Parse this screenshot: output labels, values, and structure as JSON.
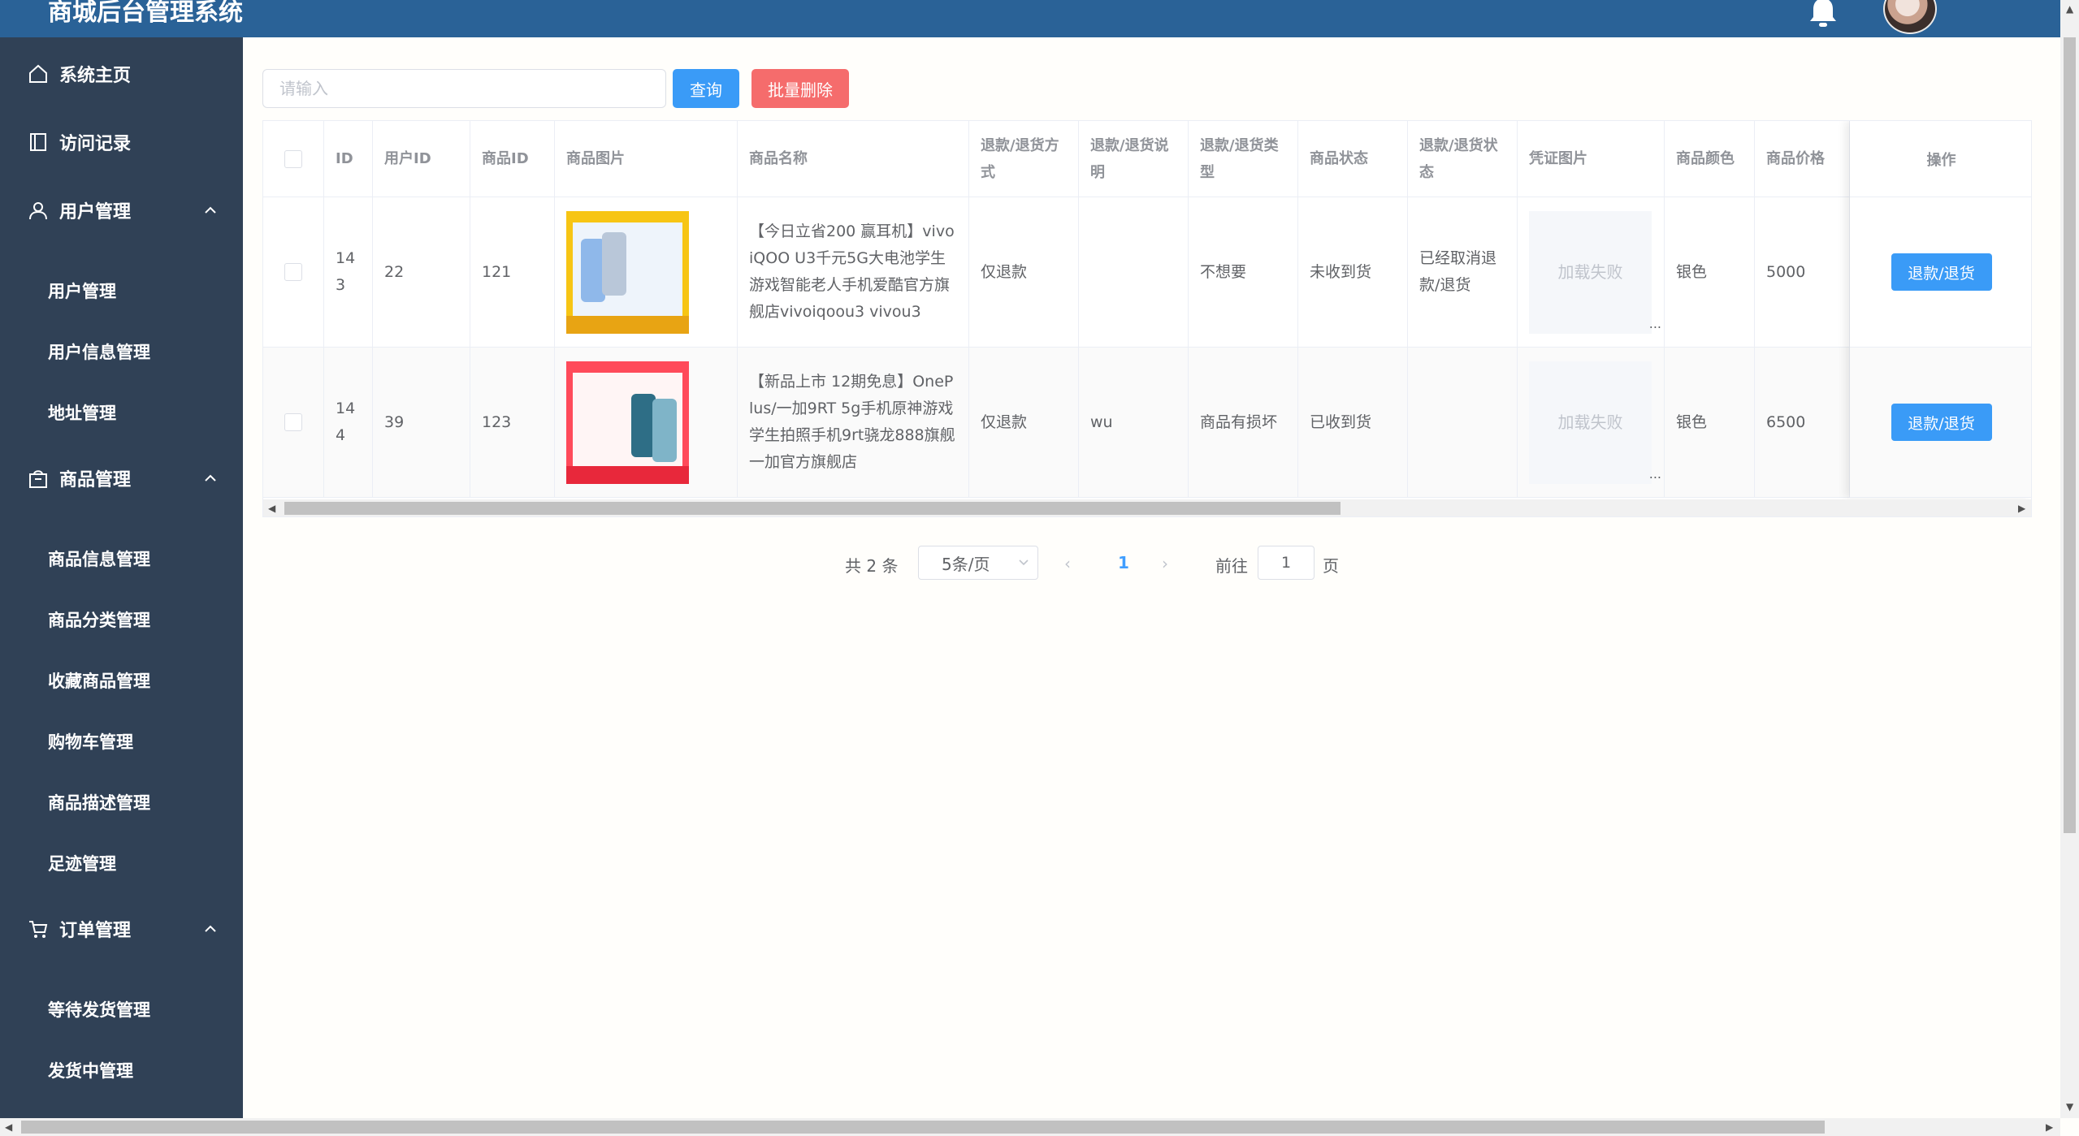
{
  "header": {
    "title": "商城后台管理系统"
  },
  "sidebar": {
    "items": [
      {
        "label": "系统主页",
        "icon": "home-icon"
      },
      {
        "label": "访问记录",
        "icon": "record-icon"
      },
      {
        "label": "用户管理",
        "icon": "user-icon",
        "expanded": true,
        "children": [
          "用户管理",
          "用户信息管理",
          "地址管理"
        ]
      },
      {
        "label": "商品管理",
        "icon": "goods-icon",
        "expanded": true,
        "children": [
          "商品信息管理",
          "商品分类管理",
          "收藏商品管理",
          "购物车管理",
          "商品描述管理",
          "足迹管理"
        ]
      },
      {
        "label": "订单管理",
        "icon": "cart-icon",
        "expanded": true,
        "children": [
          "等待发货管理",
          "发货中管理"
        ]
      }
    ]
  },
  "toolbar": {
    "search_placeholder": "请输入",
    "query_label": "查询",
    "batch_delete_label": "批量删除"
  },
  "table": {
    "columns": [
      "ID",
      "用户ID",
      "商品ID",
      "商品图片",
      "商品名称",
      "退款/退货方式",
      "退款/退货说明",
      "退款/退货类型",
      "商品状态",
      "退款/退货状态",
      "凭证图片",
      "商品颜色",
      "商品价格",
      "操作"
    ],
    "rows": [
      {
        "id": "143",
        "user_id": "22",
        "goods_id": "121",
        "image": "vivo-iqoo-product-image",
        "name": "【今日立省200 赢耳机】vivo iQOO U3千元5G大电池学生游戏智能老人手机爱酷官方旗舰店vivoiqoou3 vivou3",
        "method": "仅退款",
        "desc": "",
        "type": "不想要",
        "goods_status": "未收到货",
        "refund_status": "已经取消退款/退货",
        "voucher_text": "加载失败",
        "voucher_more": "...",
        "color": "银色",
        "price": "5000",
        "action": "退款/退货"
      },
      {
        "id": "144",
        "user_id": "39",
        "goods_id": "123",
        "image": "redmi-note10-product-image",
        "name": "【新品上市 12期免息】OnePlus/一加9RT 5g手机原神游戏学生拍照手机9rt骁龙888旗舰一加官方旗舰店",
        "method": "仅退款",
        "desc": "wu",
        "type": "商品有损坏",
        "goods_status": "已收到货",
        "refund_status": "",
        "voucher_text": "加载失败",
        "voucher_more": "...",
        "color": "银色",
        "price": "6500",
        "action": "退款/退货"
      }
    ]
  },
  "pagination": {
    "total_text": "共 2 条",
    "page_size": "5条/页",
    "current_page": "1",
    "goto_label": "前往",
    "goto_value": "1",
    "page_suffix": "页"
  },
  "colors": {
    "header_bg": "#2a6297",
    "sidebar_bg": "#304156",
    "primary": "#3a9bf7",
    "danger": "#f56c6c"
  }
}
